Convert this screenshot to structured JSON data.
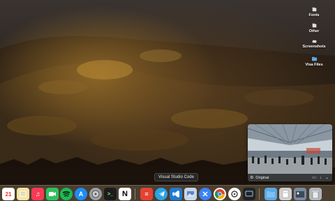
{
  "desktop": {
    "items": [
      {
        "label": "Fonts",
        "icon": "folder-icon"
      },
      {
        "label": "Other",
        "icon": "folder-icon"
      },
      {
        "label": "Screenshots",
        "icon": "folder-icon"
      },
      {
        "label": "Visa Files",
        "icon": "folder-icon"
      }
    ]
  },
  "pip": {
    "title": "Original"
  },
  "tooltip": {
    "text": "Visual Studio Code"
  },
  "dock": {
    "apps": [
      {
        "name": "calendar",
        "glyph": "21",
        "color": "#ffffff"
      },
      {
        "name": "notes",
        "glyph": "",
        "color": "#f5e3a0"
      },
      {
        "name": "music",
        "glyph": "♫",
        "color": "#fa3a55"
      },
      {
        "name": "facetime",
        "glyph": "",
        "color": "#31c05a"
      },
      {
        "name": "spotify",
        "glyph": "",
        "color": "#1db954"
      },
      {
        "name": "app-store",
        "glyph": "A",
        "color": "#1e8cf5"
      },
      {
        "name": "disk-utility",
        "glyph": "",
        "color": "#9aa0a6"
      },
      {
        "name": "terminal",
        "glyph": ">_",
        "color": "#1c1c1c"
      },
      {
        "name": "notion",
        "glyph": "N",
        "color": "#ffffff"
      },
      {
        "name": "todoist",
        "glyph": "≡",
        "color": "#e44332"
      },
      {
        "name": "telegram",
        "glyph": "",
        "color": "#2aa3e6"
      },
      {
        "name": "visual-studio-code",
        "glyph": "",
        "color": "#1f7ad1"
      },
      {
        "name": "preview",
        "glyph": "",
        "color": "#c9d6e6"
      },
      {
        "name": "xcode",
        "glyph": "",
        "color": "#3b82f6"
      },
      {
        "name": "chrome",
        "glyph": "",
        "color": "#ffffff"
      },
      {
        "name": "system-prefs",
        "glyph": "",
        "color": "#ffffff"
      },
      {
        "name": "screen-mirror",
        "glyph": "",
        "color": "#222222"
      },
      {
        "name": "downloads-folder",
        "glyph": "",
        "color": "#5aa9e6"
      },
      {
        "name": "doc-stack",
        "glyph": "",
        "color": "#cfcfcf"
      },
      {
        "name": "image-stack",
        "glyph": "",
        "color": "#7a8aa0"
      },
      {
        "name": "trash",
        "glyph": "",
        "color": "#b0b6bd"
      }
    ]
  }
}
